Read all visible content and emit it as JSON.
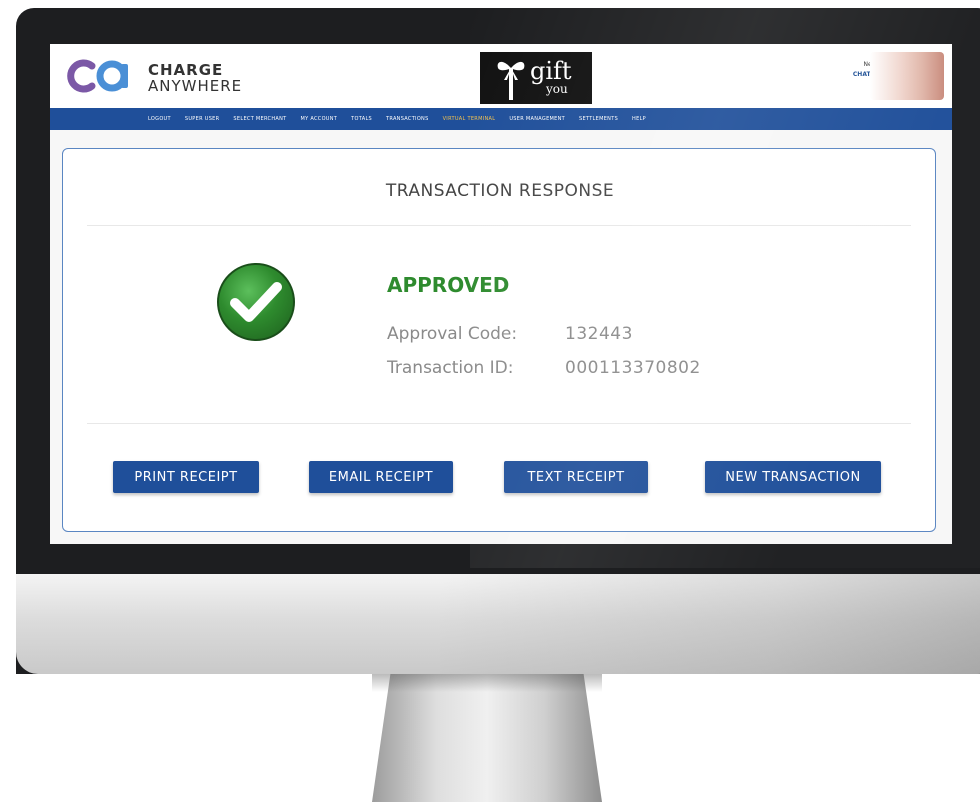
{
  "header": {
    "brand_line1": "CHARGE",
    "brand_line2": "ANYWHERE",
    "gift_text": "gift",
    "gift_subtext": "you",
    "chat_line1": "Need Help?",
    "chat_line2": "CHAT ONLINE"
  },
  "nav": {
    "items": [
      {
        "label": "LOGOUT"
      },
      {
        "label": "SUPER USER"
      },
      {
        "label": "SELECT MERCHANT"
      },
      {
        "label": "MY ACCOUNT"
      },
      {
        "label": "TOTALS"
      },
      {
        "label": "TRANSACTIONS"
      },
      {
        "label": "VIRTUAL TERMINAL"
      },
      {
        "label": "USER MANAGEMENT"
      },
      {
        "label": "SETTLEMENTS"
      },
      {
        "label": "HELP"
      }
    ],
    "active_index": 6
  },
  "response": {
    "title": "TRANSACTION RESPONSE",
    "status": "APPROVED",
    "approval_label": "Approval Code:",
    "approval_value": "132443",
    "transaction_label": "Transaction ID:",
    "transaction_value": "000113370802"
  },
  "actions": {
    "print": "PRINT RECEIPT",
    "email": "EMAIL RECEIPT",
    "text": "TEXT RECEIPT",
    "new": "NEW TRANSACTION"
  },
  "colors": {
    "nav_blue": "#1f4f9a",
    "approved_green": "#2e8b2e",
    "logo_purple": "#7b58a6",
    "logo_blue": "#4a8fd6"
  },
  "icons": {
    "status": "checkmark-circle-icon",
    "logo": "charge-anywhere-logo",
    "gift": "gift-bow-icon"
  }
}
